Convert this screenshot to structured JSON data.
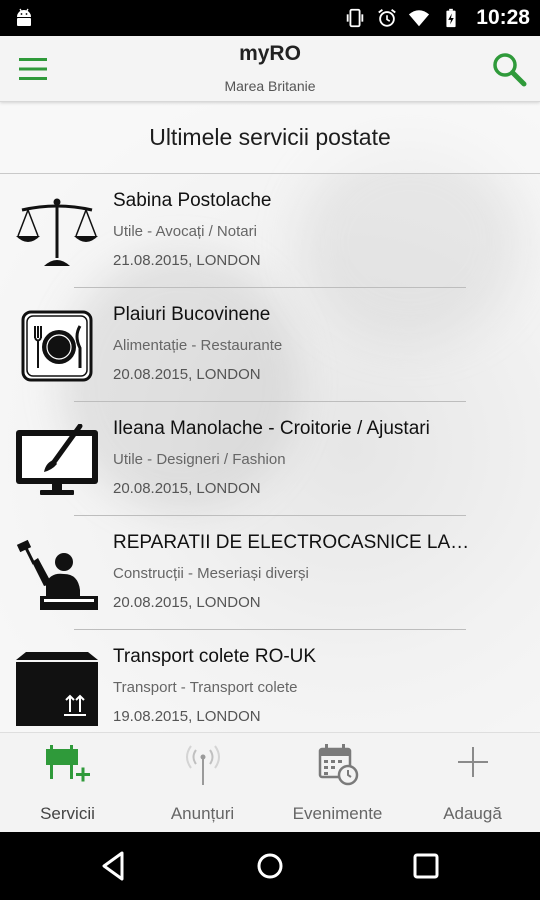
{
  "status_bar": {
    "time": "10:28",
    "icons": [
      "android-icon",
      "vibrate-icon",
      "alarm-icon",
      "wifi-icon",
      "battery-charging-icon"
    ]
  },
  "app_bar": {
    "title": "myRO",
    "subtitle": "Marea Britanie",
    "menu_icon": "hamburger-menu-icon",
    "search_icon": "search-icon"
  },
  "section": {
    "title": "Ultimele servicii postate"
  },
  "items": [
    {
      "title": "Sabina Postolache",
      "category": "Utile - Avocați / Notari",
      "date": "21.08.2015, LONDON",
      "icon": "scales-icon"
    },
    {
      "title": "Plaiuri Bucovinene",
      "category": "Alimentație - Restaurante",
      "date": "20.08.2015, LONDON",
      "icon": "plate-cutlery-icon"
    },
    {
      "title": "Ileana Manolache - Croitorie / Ajustari",
      "category": "Utile - Designeri / Fashion",
      "date": "20.08.2015, LONDON",
      "icon": "monitor-brush-icon"
    },
    {
      "title": "REPARATII DE ELECTROCASNICE LA…",
      "category": "Construcții - Meseriași diverși",
      "date": "20.08.2015, LONDON",
      "icon": "worker-hammer-icon"
    },
    {
      "title": "Transport colete RO-UK",
      "category": "Transport - Transport colete",
      "date": "19.08.2015, LONDON",
      "icon": "parcel-box-icon"
    }
  ],
  "tabs": [
    {
      "label": "Servicii",
      "icon": "signboard-add-icon",
      "active": true
    },
    {
      "label": "Anunțuri",
      "icon": "antenna-icon",
      "active": false
    },
    {
      "label": "Evenimente",
      "icon": "calendar-clock-icon",
      "active": false
    },
    {
      "label": "Adaugă",
      "icon": "plus-icon",
      "active": false
    }
  ],
  "colors": {
    "accent_green": "#2f9a3a",
    "inactive_icon": "#8a8a8a"
  },
  "nav_bar": {
    "icons": [
      "back-icon",
      "home-icon",
      "recents-icon"
    ]
  }
}
